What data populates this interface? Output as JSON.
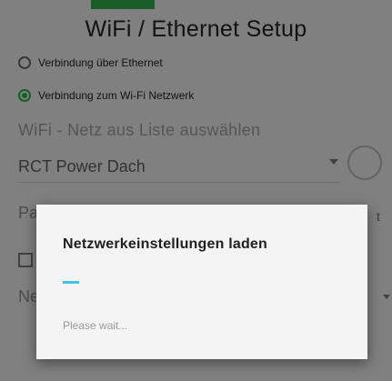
{
  "screen": {
    "title": "WiFi / Ethernet Setup",
    "options": [
      {
        "label": "Verbindung über Ethernet",
        "selected": false
      },
      {
        "label": "Verbindung zum Wi-Fi Netzwerk",
        "selected": true
      }
    ],
    "network_section_label": "WiFi - Netz aus Liste auswählen",
    "selected_network": "RCT Power Dach",
    "password_label_partial": "Pa",
    "password_side_partial": "t",
    "ne_label_partial": "Ne"
  },
  "dialog": {
    "title": "Netzwerkeinstellungen laden",
    "message": "Please wait..."
  },
  "colors": {
    "accent": "#23b04a",
    "progress": "#41c4e1"
  }
}
